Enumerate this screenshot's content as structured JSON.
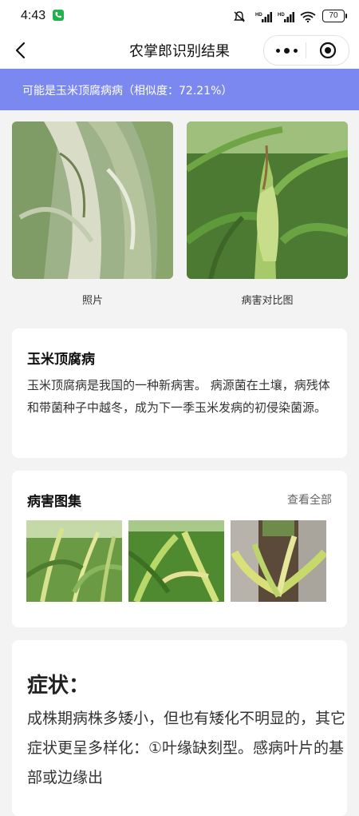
{
  "status_bar": {
    "time": "4:43",
    "battery": "70"
  },
  "nav": {
    "title": "农掌郎识别结果"
  },
  "result": {
    "text": "可能是玉米顶腐病病（相似度：72.21%）"
  },
  "photos": [
    {
      "caption": "照片"
    },
    {
      "caption": "病害对比图"
    }
  ],
  "disease": {
    "name": "玉米顶腐病",
    "description": "玉米顶腐病是我国的一种新病害。 病源菌在土壤，病残体和带菌种子中越冬，成为下一季玉米发病的初侵染菌源。"
  },
  "gallery": {
    "title": "病害图集",
    "view_all": "查看全部"
  },
  "symptoms": {
    "title": "症状：",
    "text": "成株期病株多矮小，但也有矮化不明显的，其它症状更呈多样化：①叶缘缺刻型。感病叶片的基部或边缘出"
  },
  "colors": {
    "banner": "#7b88f0",
    "background": "#f3f3f3"
  }
}
